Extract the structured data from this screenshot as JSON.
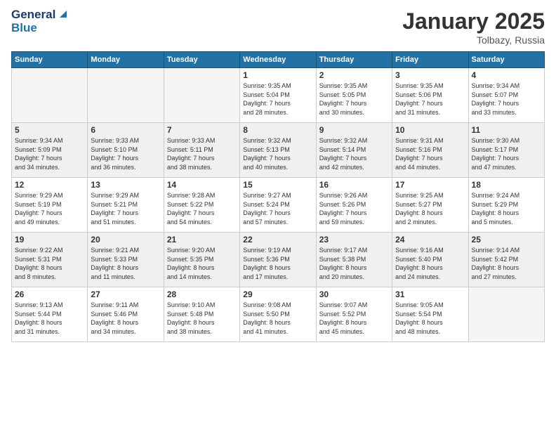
{
  "logo": {
    "line1": "General",
    "line2": "Blue"
  },
  "header": {
    "month": "January 2025",
    "location": "Tolbazy, Russia"
  },
  "days_of_week": [
    "Sunday",
    "Monday",
    "Tuesday",
    "Wednesday",
    "Thursday",
    "Friday",
    "Saturday"
  ],
  "weeks": [
    {
      "days": [
        {
          "num": "",
          "info": ""
        },
        {
          "num": "",
          "info": ""
        },
        {
          "num": "",
          "info": ""
        },
        {
          "num": "1",
          "info": "Sunrise: 9:35 AM\nSunset: 5:04 PM\nDaylight: 7 hours\nand 28 minutes."
        },
        {
          "num": "2",
          "info": "Sunrise: 9:35 AM\nSunset: 5:05 PM\nDaylight: 7 hours\nand 30 minutes."
        },
        {
          "num": "3",
          "info": "Sunrise: 9:35 AM\nSunset: 5:06 PM\nDaylight: 7 hours\nand 31 minutes."
        },
        {
          "num": "4",
          "info": "Sunrise: 9:34 AM\nSunset: 5:07 PM\nDaylight: 7 hours\nand 33 minutes."
        }
      ]
    },
    {
      "days": [
        {
          "num": "5",
          "info": "Sunrise: 9:34 AM\nSunset: 5:09 PM\nDaylight: 7 hours\nand 34 minutes."
        },
        {
          "num": "6",
          "info": "Sunrise: 9:33 AM\nSunset: 5:10 PM\nDaylight: 7 hours\nand 36 minutes."
        },
        {
          "num": "7",
          "info": "Sunrise: 9:33 AM\nSunset: 5:11 PM\nDaylight: 7 hours\nand 38 minutes."
        },
        {
          "num": "8",
          "info": "Sunrise: 9:32 AM\nSunset: 5:13 PM\nDaylight: 7 hours\nand 40 minutes."
        },
        {
          "num": "9",
          "info": "Sunrise: 9:32 AM\nSunset: 5:14 PM\nDaylight: 7 hours\nand 42 minutes."
        },
        {
          "num": "10",
          "info": "Sunrise: 9:31 AM\nSunset: 5:16 PM\nDaylight: 7 hours\nand 44 minutes."
        },
        {
          "num": "11",
          "info": "Sunrise: 9:30 AM\nSunset: 5:17 PM\nDaylight: 7 hours\nand 47 minutes."
        }
      ]
    },
    {
      "days": [
        {
          "num": "12",
          "info": "Sunrise: 9:29 AM\nSunset: 5:19 PM\nDaylight: 7 hours\nand 49 minutes."
        },
        {
          "num": "13",
          "info": "Sunrise: 9:29 AM\nSunset: 5:21 PM\nDaylight: 7 hours\nand 51 minutes."
        },
        {
          "num": "14",
          "info": "Sunrise: 9:28 AM\nSunset: 5:22 PM\nDaylight: 7 hours\nand 54 minutes."
        },
        {
          "num": "15",
          "info": "Sunrise: 9:27 AM\nSunset: 5:24 PM\nDaylight: 7 hours\nand 57 minutes."
        },
        {
          "num": "16",
          "info": "Sunrise: 9:26 AM\nSunset: 5:26 PM\nDaylight: 7 hours\nand 59 minutes."
        },
        {
          "num": "17",
          "info": "Sunrise: 9:25 AM\nSunset: 5:27 PM\nDaylight: 8 hours\nand 2 minutes."
        },
        {
          "num": "18",
          "info": "Sunrise: 9:24 AM\nSunset: 5:29 PM\nDaylight: 8 hours\nand 5 minutes."
        }
      ]
    },
    {
      "days": [
        {
          "num": "19",
          "info": "Sunrise: 9:22 AM\nSunset: 5:31 PM\nDaylight: 8 hours\nand 8 minutes."
        },
        {
          "num": "20",
          "info": "Sunrise: 9:21 AM\nSunset: 5:33 PM\nDaylight: 8 hours\nand 11 minutes."
        },
        {
          "num": "21",
          "info": "Sunrise: 9:20 AM\nSunset: 5:35 PM\nDaylight: 8 hours\nand 14 minutes."
        },
        {
          "num": "22",
          "info": "Sunrise: 9:19 AM\nSunset: 5:36 PM\nDaylight: 8 hours\nand 17 minutes."
        },
        {
          "num": "23",
          "info": "Sunrise: 9:17 AM\nSunset: 5:38 PM\nDaylight: 8 hours\nand 20 minutes."
        },
        {
          "num": "24",
          "info": "Sunrise: 9:16 AM\nSunset: 5:40 PM\nDaylight: 8 hours\nand 24 minutes."
        },
        {
          "num": "25",
          "info": "Sunrise: 9:14 AM\nSunset: 5:42 PM\nDaylight: 8 hours\nand 27 minutes."
        }
      ]
    },
    {
      "days": [
        {
          "num": "26",
          "info": "Sunrise: 9:13 AM\nSunset: 5:44 PM\nDaylight: 8 hours\nand 31 minutes."
        },
        {
          "num": "27",
          "info": "Sunrise: 9:11 AM\nSunset: 5:46 PM\nDaylight: 8 hours\nand 34 minutes."
        },
        {
          "num": "28",
          "info": "Sunrise: 9:10 AM\nSunset: 5:48 PM\nDaylight: 8 hours\nand 38 minutes."
        },
        {
          "num": "29",
          "info": "Sunrise: 9:08 AM\nSunset: 5:50 PM\nDaylight: 8 hours\nand 41 minutes."
        },
        {
          "num": "30",
          "info": "Sunrise: 9:07 AM\nSunset: 5:52 PM\nDaylight: 8 hours\nand 45 minutes."
        },
        {
          "num": "31",
          "info": "Sunrise: 9:05 AM\nSunset: 5:54 PM\nDaylight: 8 hours\nand 48 minutes."
        },
        {
          "num": "",
          "info": ""
        }
      ]
    }
  ]
}
